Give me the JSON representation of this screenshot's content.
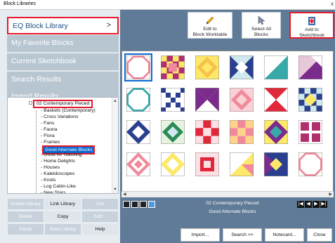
{
  "window": {
    "title": "Block Libraries",
    "close_glyph": "x"
  },
  "nav": [
    {
      "label": "EQ Block Library",
      "chevron": ">"
    },
    {
      "label": "My Favorite Blocks"
    },
    {
      "label": "Current Sketchbook"
    },
    {
      "label": "Search Results"
    },
    {
      "label": "Import Results"
    }
  ],
  "tree": {
    "root": "02 Contemporary Pieced",
    "items": [
      "Baskets (Contemporary)",
      "Cross Variations",
      "Fans",
      "Fauna",
      "Flora",
      "Frames",
      "Good Alternate Blocks",
      "Good for Stacking",
      "Home Delights",
      "Houses",
      "Kaleidoscopes",
      "Knots",
      "Log Cabin-Like",
      "New Stars"
    ],
    "selected_index": 6
  },
  "library_buttons": [
    {
      "label": "Create Library",
      "enabled": false
    },
    {
      "label": "Link Library",
      "enabled": true
    },
    {
      "label": "Cut",
      "enabled": false
    },
    {
      "label": "Delete",
      "enabled": false
    },
    {
      "label": "Copy",
      "enabled": true
    },
    {
      "label": "Sort...",
      "enabled": false
    },
    {
      "label": "Paste",
      "enabled": false
    },
    {
      "label": "Save Library",
      "enabled": false
    },
    {
      "label": "Help",
      "enabled": true
    }
  ],
  "toolbar": {
    "edit": {
      "line1": "Edit to",
      "line2": "Block Worktable",
      "icon": "pencil-icon"
    },
    "select_all": {
      "line1": "Select All",
      "line2": "Blocks",
      "icon": "cursor-icon"
    },
    "add": {
      "line1": "Add to",
      "line2": "Sketchbook",
      "icon": "sketchbook-add-icon"
    }
  },
  "caption": {
    "line1": "02 Contemporary Pieced",
    "line2": "Good Alternate Blocks"
  },
  "bottom_buttons": {
    "import": "Import...",
    "search": "Search  >>",
    "notecard": "Notecard...",
    "close": "Close"
  },
  "colors": {
    "highlight": "#e8192c",
    "selection": "#0a68d0",
    "panel": "#5f7b97"
  }
}
